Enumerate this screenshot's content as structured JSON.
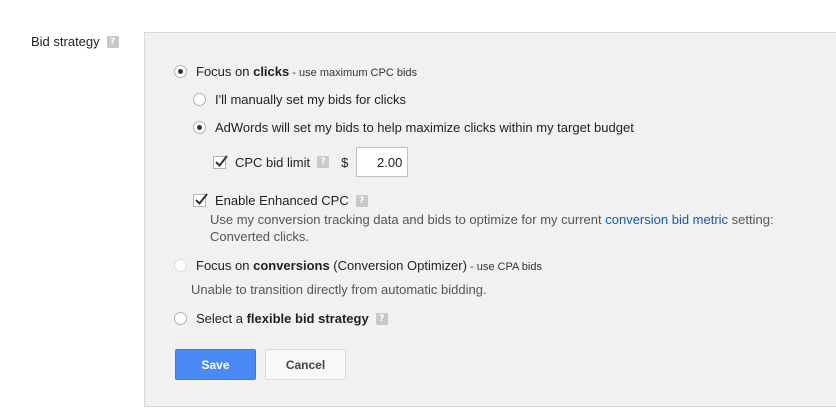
{
  "section": {
    "label": "Bid strategy",
    "help": "?"
  },
  "focus_clicks": {
    "label_prefix": "Focus on ",
    "label_bold": "clicks",
    "label_suffix": " - use maximum CPC bids",
    "options": {
      "manual_label": "I'll manually set my bids for clicks",
      "auto_label": "AdWords will set my bids to help maximize clicks within my target budget"
    },
    "cpc_limit": {
      "label": "CPC bid limit",
      "currency": "$",
      "value": "2.00",
      "help": "?"
    }
  },
  "enhanced_cpc": {
    "label": "Enable Enhanced CPC",
    "help": "?",
    "desc_prefix": "Use my conversion tracking data and bids to optimize for my current ",
    "desc_link": "conversion bid metric",
    "desc_suffix": " setting:",
    "desc_line2": "Converted clicks."
  },
  "focus_conversions": {
    "label_prefix": "Focus on ",
    "label_bold": "conversions",
    "label_mid": " (Conversion Optimizer)",
    "label_suffix": " - use CPA bids",
    "note": "Unable to transition directly from automatic bidding."
  },
  "flexible": {
    "label_prefix": "Select a ",
    "label_bold": "flexible bid strategy",
    "help": "?"
  },
  "buttons": {
    "save": "Save",
    "cancel": "Cancel"
  }
}
